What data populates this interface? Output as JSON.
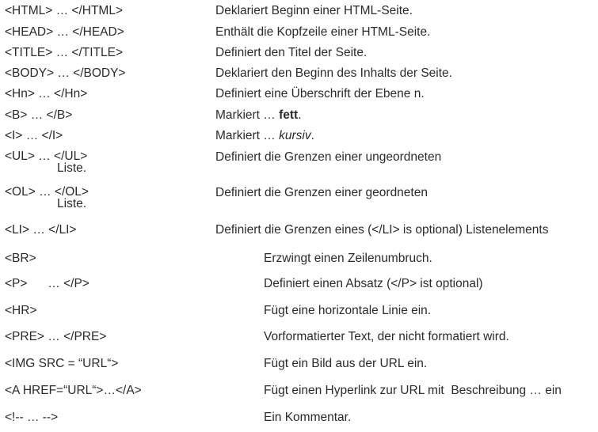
{
  "rows": [
    {
      "tag": "<HTML> … </HTML>",
      "desc": "Deklariert Beginn einer HTML-Seite."
    },
    {
      "tag": "<HEAD> … </HEAD>",
      "desc": "Enthält die Kopfzeile einer HTML-Seite."
    },
    {
      "tag": "<TITLE> … </TITLE>",
      "desc": "Definiert den Titel der Seite."
    },
    {
      "tag": "<BODY> … </BODY>",
      "desc": "Deklariert den Beginn des Inhalts der Seite."
    },
    {
      "tag": "<Hn> … </Hn>",
      "desc": "Definiert eine Überschrift der Ebene n."
    },
    {
      "tag": "<B> … </B>",
      "desc_prefix": "Markiert … ",
      "desc_emph": "fett",
      "desc_suffix": "."
    },
    {
      "tag": "<I> … </I>",
      "desc_prefix": "Markiert … ",
      "desc_emph": "kursiv",
      "desc_suffix": "."
    },
    {
      "tag": "<UL> … </UL>",
      "tag_cont": "Liste.",
      "desc": "Definiert die Grenzen einer ungeordneten"
    },
    {
      "tag": "<OL> … </OL>",
      "tag_cont": "Liste.",
      "desc": "Definiert die Grenzen einer geordneten"
    },
    {
      "tag": "<LI> … </LI>",
      "desc": "Definiert die Grenzen eines (</LI> is optional) Listenelements"
    },
    {
      "tag": "<BR>",
      "desc": "Erzwingt einen Zeilenumbruch."
    },
    {
      "tag": "<P>      … </P>",
      "desc": "Definiert einen Absatz (</P> ist optional)"
    },
    {
      "tag": "<HR>",
      "desc": "Fügt eine horizontale Linie ein."
    },
    {
      "tag": "<PRE> … </PRE>",
      "desc": "Vorformatierter Text, der nicht formatiert wird."
    },
    {
      "tag": "<IMG SRC = “URL“>",
      "desc": "Fügt ein Bild aus der URL ein."
    },
    {
      "tag": "<A HREF=“URL“>…</A>",
      "desc": "Fügt einen Hyperlink zur URL mit  Beschreibung … ein"
    },
    {
      "tag": "<!-- … -->",
      "desc": "Ein Kommentar."
    }
  ]
}
